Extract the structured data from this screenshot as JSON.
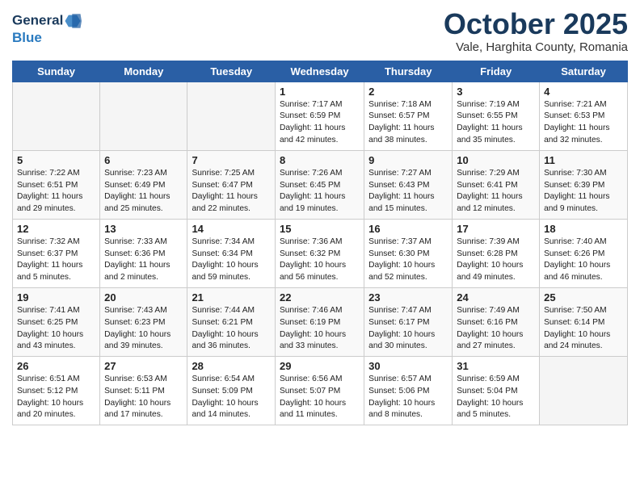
{
  "logo": {
    "line1": "General",
    "line2": "Blue"
  },
  "title": "October 2025",
  "location": "Vale, Harghita County, Romania",
  "days_header": [
    "Sunday",
    "Monday",
    "Tuesday",
    "Wednesday",
    "Thursday",
    "Friday",
    "Saturday"
  ],
  "weeks": [
    [
      {
        "num": "",
        "sunrise": "",
        "sunset": "",
        "daylight": ""
      },
      {
        "num": "",
        "sunrise": "",
        "sunset": "",
        "daylight": ""
      },
      {
        "num": "",
        "sunrise": "",
        "sunset": "",
        "daylight": ""
      },
      {
        "num": "1",
        "sunrise": "Sunrise: 7:17 AM",
        "sunset": "Sunset: 6:59 PM",
        "daylight": "Daylight: 11 hours and 42 minutes."
      },
      {
        "num": "2",
        "sunrise": "Sunrise: 7:18 AM",
        "sunset": "Sunset: 6:57 PM",
        "daylight": "Daylight: 11 hours and 38 minutes."
      },
      {
        "num": "3",
        "sunrise": "Sunrise: 7:19 AM",
        "sunset": "Sunset: 6:55 PM",
        "daylight": "Daylight: 11 hours and 35 minutes."
      },
      {
        "num": "4",
        "sunrise": "Sunrise: 7:21 AM",
        "sunset": "Sunset: 6:53 PM",
        "daylight": "Daylight: 11 hours and 32 minutes."
      }
    ],
    [
      {
        "num": "5",
        "sunrise": "Sunrise: 7:22 AM",
        "sunset": "Sunset: 6:51 PM",
        "daylight": "Daylight: 11 hours and 29 minutes."
      },
      {
        "num": "6",
        "sunrise": "Sunrise: 7:23 AM",
        "sunset": "Sunset: 6:49 PM",
        "daylight": "Daylight: 11 hours and 25 minutes."
      },
      {
        "num": "7",
        "sunrise": "Sunrise: 7:25 AM",
        "sunset": "Sunset: 6:47 PM",
        "daylight": "Daylight: 11 hours and 22 minutes."
      },
      {
        "num": "8",
        "sunrise": "Sunrise: 7:26 AM",
        "sunset": "Sunset: 6:45 PM",
        "daylight": "Daylight: 11 hours and 19 minutes."
      },
      {
        "num": "9",
        "sunrise": "Sunrise: 7:27 AM",
        "sunset": "Sunset: 6:43 PM",
        "daylight": "Daylight: 11 hours and 15 minutes."
      },
      {
        "num": "10",
        "sunrise": "Sunrise: 7:29 AM",
        "sunset": "Sunset: 6:41 PM",
        "daylight": "Daylight: 11 hours and 12 minutes."
      },
      {
        "num": "11",
        "sunrise": "Sunrise: 7:30 AM",
        "sunset": "Sunset: 6:39 PM",
        "daylight": "Daylight: 11 hours and 9 minutes."
      }
    ],
    [
      {
        "num": "12",
        "sunrise": "Sunrise: 7:32 AM",
        "sunset": "Sunset: 6:37 PM",
        "daylight": "Daylight: 11 hours and 5 minutes."
      },
      {
        "num": "13",
        "sunrise": "Sunrise: 7:33 AM",
        "sunset": "Sunset: 6:36 PM",
        "daylight": "Daylight: 11 hours and 2 minutes."
      },
      {
        "num": "14",
        "sunrise": "Sunrise: 7:34 AM",
        "sunset": "Sunset: 6:34 PM",
        "daylight": "Daylight: 10 hours and 59 minutes."
      },
      {
        "num": "15",
        "sunrise": "Sunrise: 7:36 AM",
        "sunset": "Sunset: 6:32 PM",
        "daylight": "Daylight: 10 hours and 56 minutes."
      },
      {
        "num": "16",
        "sunrise": "Sunrise: 7:37 AM",
        "sunset": "Sunset: 6:30 PM",
        "daylight": "Daylight: 10 hours and 52 minutes."
      },
      {
        "num": "17",
        "sunrise": "Sunrise: 7:39 AM",
        "sunset": "Sunset: 6:28 PM",
        "daylight": "Daylight: 10 hours and 49 minutes."
      },
      {
        "num": "18",
        "sunrise": "Sunrise: 7:40 AM",
        "sunset": "Sunset: 6:26 PM",
        "daylight": "Daylight: 10 hours and 46 minutes."
      }
    ],
    [
      {
        "num": "19",
        "sunrise": "Sunrise: 7:41 AM",
        "sunset": "Sunset: 6:25 PM",
        "daylight": "Daylight: 10 hours and 43 minutes."
      },
      {
        "num": "20",
        "sunrise": "Sunrise: 7:43 AM",
        "sunset": "Sunset: 6:23 PM",
        "daylight": "Daylight: 10 hours and 39 minutes."
      },
      {
        "num": "21",
        "sunrise": "Sunrise: 7:44 AM",
        "sunset": "Sunset: 6:21 PM",
        "daylight": "Daylight: 10 hours and 36 minutes."
      },
      {
        "num": "22",
        "sunrise": "Sunrise: 7:46 AM",
        "sunset": "Sunset: 6:19 PM",
        "daylight": "Daylight: 10 hours and 33 minutes."
      },
      {
        "num": "23",
        "sunrise": "Sunrise: 7:47 AM",
        "sunset": "Sunset: 6:17 PM",
        "daylight": "Daylight: 10 hours and 30 minutes."
      },
      {
        "num": "24",
        "sunrise": "Sunrise: 7:49 AM",
        "sunset": "Sunset: 6:16 PM",
        "daylight": "Daylight: 10 hours and 27 minutes."
      },
      {
        "num": "25",
        "sunrise": "Sunrise: 7:50 AM",
        "sunset": "Sunset: 6:14 PM",
        "daylight": "Daylight: 10 hours and 24 minutes."
      }
    ],
    [
      {
        "num": "26",
        "sunrise": "Sunrise: 6:51 AM",
        "sunset": "Sunset: 5:12 PM",
        "daylight": "Daylight: 10 hours and 20 minutes."
      },
      {
        "num": "27",
        "sunrise": "Sunrise: 6:53 AM",
        "sunset": "Sunset: 5:11 PM",
        "daylight": "Daylight: 10 hours and 17 minutes."
      },
      {
        "num": "28",
        "sunrise": "Sunrise: 6:54 AM",
        "sunset": "Sunset: 5:09 PM",
        "daylight": "Daylight: 10 hours and 14 minutes."
      },
      {
        "num": "29",
        "sunrise": "Sunrise: 6:56 AM",
        "sunset": "Sunset: 5:07 PM",
        "daylight": "Daylight: 10 hours and 11 minutes."
      },
      {
        "num": "30",
        "sunrise": "Sunrise: 6:57 AM",
        "sunset": "Sunset: 5:06 PM",
        "daylight": "Daylight: 10 hours and 8 minutes."
      },
      {
        "num": "31",
        "sunrise": "Sunrise: 6:59 AM",
        "sunset": "Sunset: 5:04 PM",
        "daylight": "Daylight: 10 hours and 5 minutes."
      },
      {
        "num": "",
        "sunrise": "",
        "sunset": "",
        "daylight": ""
      }
    ]
  ]
}
